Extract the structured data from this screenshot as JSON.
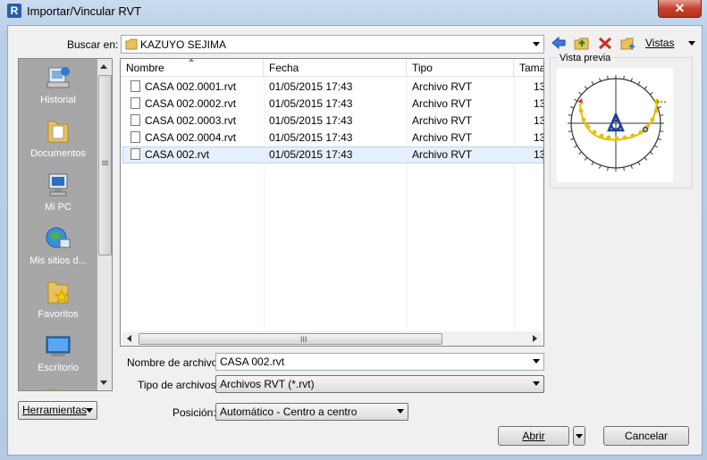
{
  "window": {
    "title": "Importar/Vincular RVT",
    "close_glyph": "✕"
  },
  "lookin": {
    "label": "Buscar en:",
    "value": "KAZUYO SEJIMA"
  },
  "toolbar": {
    "views_label": "Vistas"
  },
  "sidebar": {
    "items": [
      {
        "label": "Historial",
        "icon": "history-icon"
      },
      {
        "label": "Documentos",
        "icon": "documents-folder-icon"
      },
      {
        "label": "Mi PC",
        "icon": "computer-icon"
      },
      {
        "label": "Mis sitios d...",
        "icon": "network-places-icon"
      },
      {
        "label": "Favoritos",
        "icon": "favorites-folder-icon"
      },
      {
        "label": "Escritorio",
        "icon": "desktop-icon"
      }
    ]
  },
  "filelist": {
    "columns": [
      "Nombre",
      "Fecha",
      "Tipo",
      "Tama"
    ],
    "rows": [
      {
        "name": "CASA 002.0001.rvt",
        "date": "01/05/2015 17:43",
        "type": "Archivo RVT",
        "size": "13"
      },
      {
        "name": "CASA 002.0002.rvt",
        "date": "01/05/2015 17:43",
        "type": "Archivo RVT",
        "size": "13"
      },
      {
        "name": "CASA 002.0003.rvt",
        "date": "01/05/2015 17:43",
        "type": "Archivo RVT",
        "size": "13"
      },
      {
        "name": "CASA 002.0004.rvt",
        "date": "01/05/2015 17:43",
        "type": "Archivo RVT",
        "size": "13"
      },
      {
        "name": "CASA 002.rvt",
        "date": "01/05/2015 17:43",
        "type": "Archivo RVT",
        "size": "13",
        "selected": true
      }
    ],
    "scroll_grip": "III"
  },
  "preview": {
    "label": "Vista previa"
  },
  "filename": {
    "label": "Nombre de archivo:",
    "value": "CASA 002.rvt"
  },
  "filetype": {
    "label": "Tipo de archivos:",
    "value": "Archivos RVT  (*.rvt)"
  },
  "position": {
    "label": "Posición:",
    "value": "Automático - Centro a centro"
  },
  "buttons": {
    "tools": "Herramientas",
    "open": "Abrir",
    "cancel": "Cancelar"
  }
}
